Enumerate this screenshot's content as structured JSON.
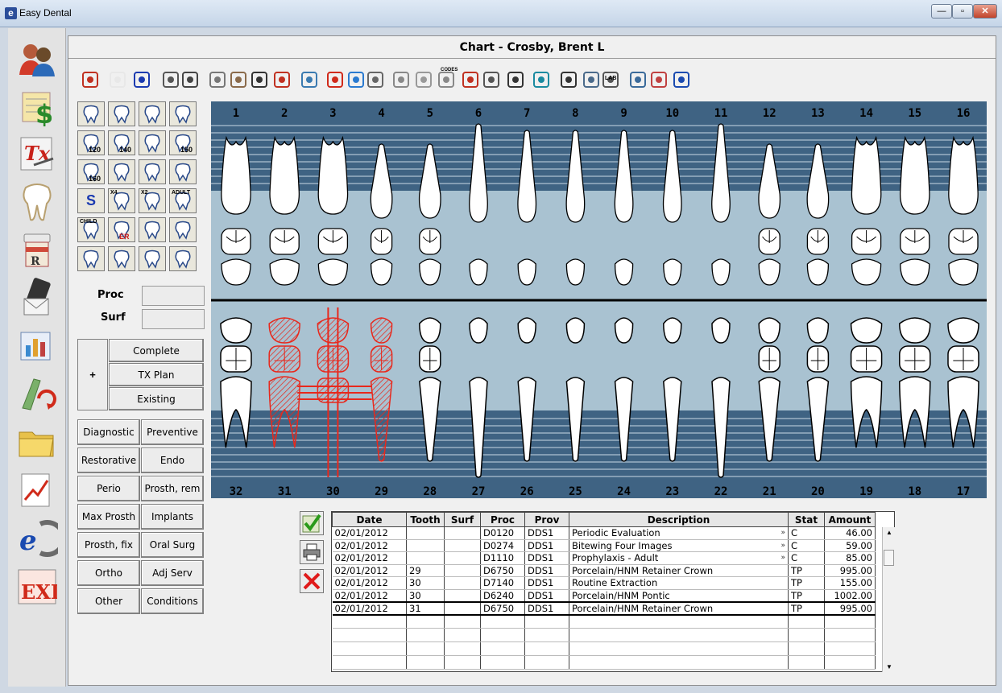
{
  "window": {
    "title": "Easy Dental",
    "logo_letter": "e",
    "minimize": "—",
    "maximize": "▫",
    "close": "✕"
  },
  "chart": {
    "title": "Chart - Crosby, Brent L"
  },
  "sidebar": {
    "items": [
      "patients-icon",
      "billing-icon",
      "treatment-plan-icon",
      "tooth-chart-icon",
      "prescription-icon",
      "communication-icon",
      "reports-icon",
      "connect-icon",
      "documents-icon",
      "analytics-icon",
      "easy-dental-logo-icon",
      "exit-icon"
    ],
    "exit_label": "EXIT",
    "tx_label": "Tx"
  },
  "toolbar": {
    "icons": [
      "patient-select-icon",
      "medical-alert-icon",
      "flag-icon",
      "print-icon",
      "clipboard-icon",
      "instruments-icon",
      "perio-icon",
      "search-patient-icon",
      "patient-info-icon",
      "appointment-icon",
      "notes-icon",
      "message-icon",
      "email-icon",
      "xray-icon",
      "implant-icon",
      "codes-tooth-icon",
      "extraction-icon",
      "stethoscope-icon",
      "continuing-care-icon",
      "refresh-icon",
      "camera-icon",
      "image-icon",
      "lab-icon",
      "settings-icon",
      "colors-icon",
      "help-icon"
    ],
    "codes_label": "CODES",
    "lab_label": "LAB"
  },
  "tool_grid": {
    "buttons": [
      [
        "",
        "",
        "",
        ""
      ],
      [
        "120",
        "140",
        "",
        "150"
      ],
      [
        "160",
        "",
        "",
        ""
      ],
      [
        "S",
        "X4",
        "X2",
        "ADULT"
      ],
      [
        "CHILD",
        "ER",
        "",
        ""
      ],
      [
        "",
        "",
        "",
        ""
      ]
    ]
  },
  "proc_entry": {
    "proc_label": "Proc",
    "surf_label": "Surf",
    "proc_value": "",
    "surf_value": ""
  },
  "status_buttons": {
    "plus": "+",
    "complete": "Complete",
    "tx_plan": "TX Plan",
    "existing": "Existing"
  },
  "categories": [
    [
      "Diagnostic",
      "Preventive"
    ],
    [
      "Restorative",
      "Endo"
    ],
    [
      "Perio",
      "Prosth, rem"
    ],
    [
      "Max Prosth",
      "Implants"
    ],
    [
      "Prosth, fix",
      "Oral Surg"
    ],
    [
      "Ortho",
      "Adj Serv"
    ],
    [
      "Other",
      "Conditions"
    ]
  ],
  "tooth_chart": {
    "upper_numbers": [
      "1",
      "2",
      "3",
      "4",
      "5",
      "6",
      "7",
      "8",
      "9",
      "10",
      "11",
      "12",
      "13",
      "14",
      "15",
      "16"
    ],
    "lower_numbers": [
      "32",
      "31",
      "30",
      "29",
      "28",
      "27",
      "26",
      "25",
      "24",
      "23",
      "22",
      "21",
      "20",
      "19",
      "18",
      "17"
    ],
    "colors": {
      "band": "#3f6383",
      "bg": "#a9c2d1",
      "tooth": "#ffffff",
      "planned": "#e8281c"
    },
    "planned_teeth": [
      "31",
      "30",
      "29"
    ],
    "extracted_teeth": [
      "30"
    ]
  },
  "procedures": {
    "headers": [
      "Date",
      "Tooth",
      "Surf",
      "Proc",
      "Prov",
      "Description",
      "Stat",
      "Amount"
    ],
    "rows": [
      [
        "02/01/2012",
        "",
        "",
        "D0120",
        "DDS1",
        "Periodic Evaluation",
        "C",
        "46.00"
      ],
      [
        "02/01/2012",
        "",
        "",
        "D0274",
        "DDS1",
        "Bitewing Four Images",
        "C",
        "59.00"
      ],
      [
        "02/01/2012",
        "",
        "",
        "D1110",
        "DDS1",
        "Prophylaxis - Adult",
        "C",
        "85.00"
      ],
      [
        "02/01/2012",
        "29",
        "",
        "D6750",
        "DDS1",
        "Porcelain/HNM Retainer Crown",
        "TP",
        "995.00"
      ],
      [
        "02/01/2012",
        "30",
        "",
        "D7140",
        "DDS1",
        "Routine Extraction",
        "TP",
        "155.00"
      ],
      [
        "02/01/2012",
        "30",
        "",
        "D6240",
        "DDS1",
        "Porcelain/HNM Pontic",
        "TP",
        "1002.00"
      ],
      [
        "02/01/2012",
        "31",
        "",
        "D6750",
        "DDS1",
        "Porcelain/HNM Retainer Crown",
        "TP",
        "995.00"
      ]
    ],
    "more_marks": [
      "»",
      "»",
      "»"
    ],
    "empty_rows": 4,
    "selected_row": 6
  }
}
